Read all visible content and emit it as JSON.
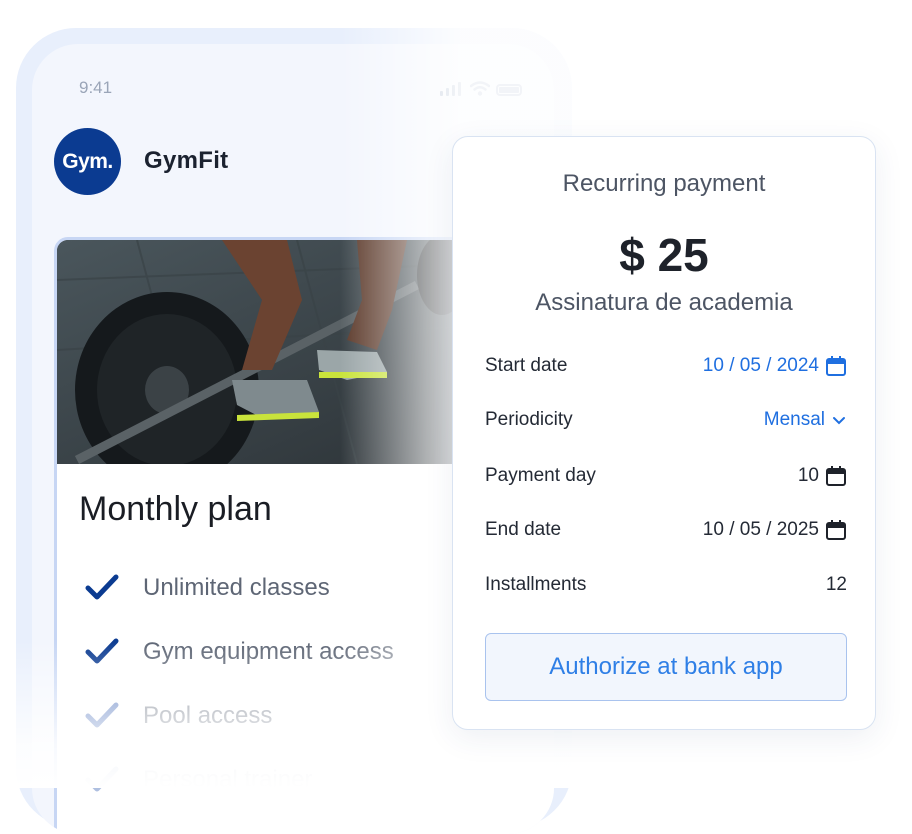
{
  "status_bar": {
    "time": "9:41"
  },
  "app": {
    "logo_text": "Gym.",
    "name": "GymFit"
  },
  "plan": {
    "title": "Monthly plan",
    "features": [
      {
        "label": "Unlimited classes",
        "check_color": "#0b3b91"
      },
      {
        "label": "Gym equipment access",
        "check_color": "#0b3b91"
      },
      {
        "label": "Pool access",
        "check_color": "#5b7cc0"
      },
      {
        "label": "Personal trainer",
        "check_color": "#aebfe0"
      }
    ]
  },
  "payment": {
    "title": "Recurring payment",
    "amount": "$ 25",
    "description": "Assinatura de academia",
    "fields": {
      "start_date": {
        "label": "Start date",
        "value": "10 / 05 / 2024"
      },
      "periodicity": {
        "label": "Periodicity",
        "value": "Mensal"
      },
      "payment_day": {
        "label": "Payment day",
        "value": "10"
      },
      "end_date": {
        "label": "End date",
        "value": "10 / 05 / 2025"
      },
      "installments": {
        "label": "Installments",
        "value": "12"
      }
    },
    "authorize_label": "Authorize at bank app"
  },
  "colors": {
    "brand": "#0b3b91",
    "accent": "#1f6fe0",
    "button_text": "#2f7fe6"
  }
}
